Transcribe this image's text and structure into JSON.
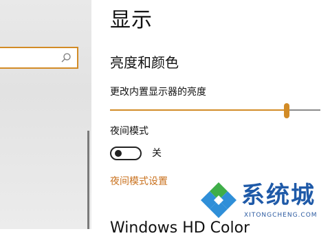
{
  "sidebar": {
    "search": {
      "value": "",
      "placeholder": ""
    }
  },
  "main": {
    "title": "显示",
    "section_title": "亮度和颜色",
    "brightness": {
      "label": "更改内置显示器的亮度",
      "level_percent": 84
    },
    "night_light": {
      "label": "夜间模式",
      "state": "关",
      "on": false
    },
    "night_settings_link": "夜间模式设置",
    "next_heading": "Windows HD Color"
  },
  "watermark": {
    "brand": "系统城",
    "url": "XITONGCHENG.COM"
  },
  "colors": {
    "accent": "#d28b26",
    "link": "#c9711e",
    "brand_blue": "#1f5aa8"
  }
}
